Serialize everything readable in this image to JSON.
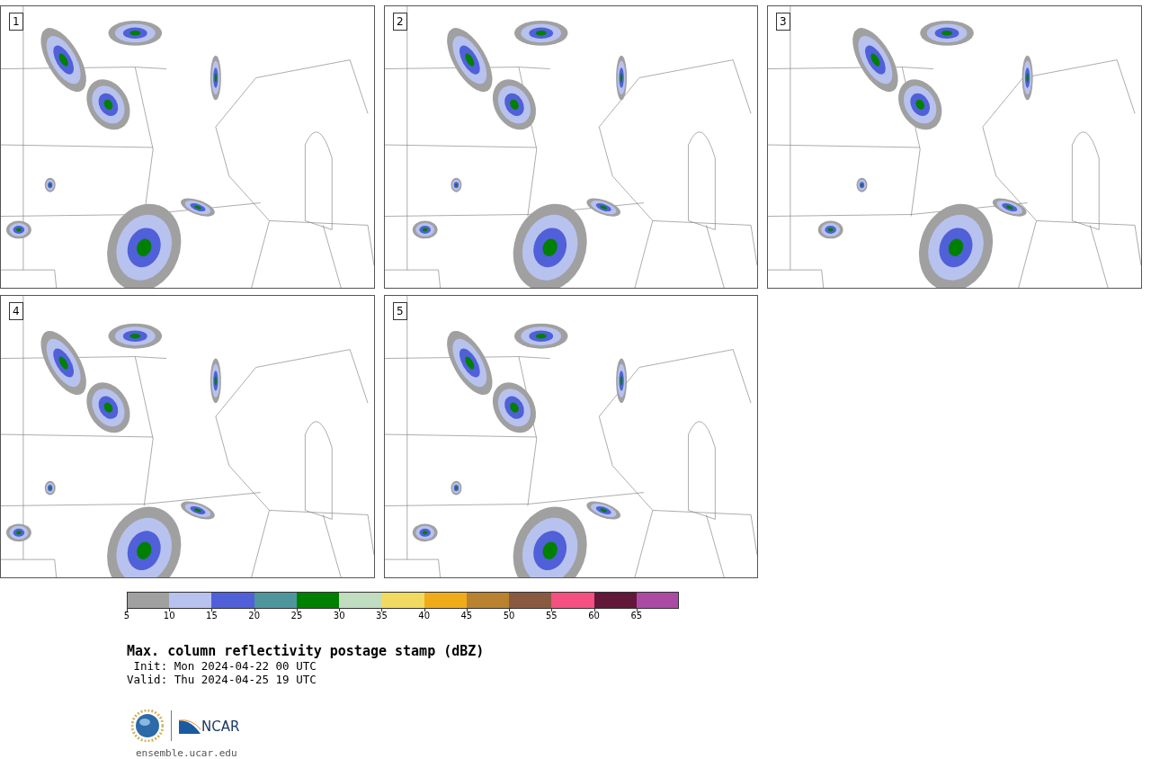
{
  "panels": [
    {
      "label": "1"
    },
    {
      "label": "2"
    },
    {
      "label": "3"
    },
    {
      "label": "4"
    },
    {
      "label": "5"
    }
  ],
  "colorbar": {
    "segments": [
      {
        "color": "#a0a0a0"
      },
      {
        "color": "#b8c2ee"
      },
      {
        "color": "#5060d8"
      },
      {
        "color": "#4e969c"
      },
      {
        "color": "#008000"
      },
      {
        "color": "#c0ddc0"
      },
      {
        "color": "#f0da60"
      },
      {
        "color": "#f0ac18"
      },
      {
        "color": "#b88230"
      },
      {
        "color": "#8a5a40"
      },
      {
        "color": "#f45080"
      },
      {
        "color": "#621838"
      },
      {
        "color": "#aa4aa4"
      }
    ],
    "ticks": [
      "5",
      "10",
      "15",
      "20",
      "25",
      "30",
      "35",
      "40",
      "45",
      "50",
      "55",
      "60",
      "65"
    ]
  },
  "title": "Max. column reflectivity postage stamp (dBZ)",
  "init": " Init: Mon 2024-04-22 00 UTC",
  "valid": "Valid: Thu 2024-04-25 19 UTC",
  "logo": {
    "text": "NCAR"
  },
  "site": "ensemble.ucar.edu"
}
